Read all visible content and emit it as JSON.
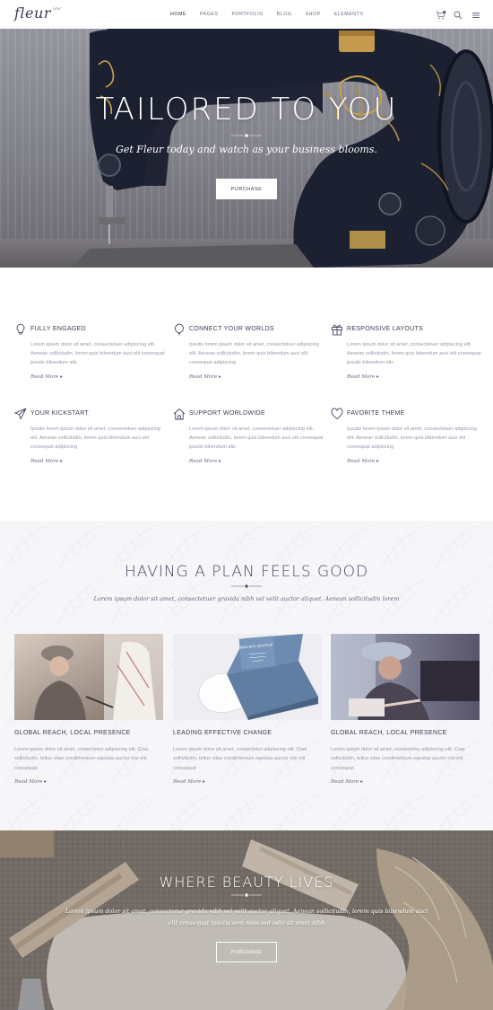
{
  "header": {
    "logo": "fleur",
    "nav": [
      "HOME",
      "PAGES",
      "PORTFOLIO",
      "BLOG",
      "SHOP",
      "ELEMENTS"
    ],
    "cart_count": "0"
  },
  "hero": {
    "title": "TAILORED TO YOU",
    "subtitle": "Get Fleur today and watch as your business blooms.",
    "button": "PURCHASE"
  },
  "features": [
    {
      "icon": "lightbulb-icon",
      "title": "FULLY ENGAGED",
      "text": "Lorem ipsum dolor sit amet, consectetuer adipiscing elit. Aenean sollicitudin, lorem quis bibendum auci elit consequat ipsutis bibendum alis",
      "more": "Read More ▸"
    },
    {
      "icon": "balloon-icon",
      "title": "CONNECT YOUR WORLDS",
      "text": "Ipsutis lorem ipsum dolor sit amet, consectetuer adipiscing elit. Aenean sollicitudin, lorem quis bibendum auci elit consequat adipiscing",
      "more": "Read More ▸"
    },
    {
      "icon": "gift-icon",
      "title": "RESPONSIVE LAYOUTS",
      "text": "Lorem ipsum dolor sit amet, consectetuer adipiscing elit. Aenean sollicitudin, lorem quis bibendum auci elit consequat ipsutis bibendum alis",
      "more": "Read More ▸"
    },
    {
      "icon": "paper-plane-icon",
      "title": "YOUR KICKSTART",
      "text": "Ipsutis lorem ipsum dolor sit amet, consectetuer adipiscing elit. Aenean sollicitudin, lorem quis bibendum auci elit consequat adipiscing",
      "more": "Read More ▸"
    },
    {
      "icon": "house-icon",
      "title": "SUPPORT WORLDWIDE",
      "text": "Lorem ipsum dolor sit amet, consectetuer adipiscing elit. Aenean sollicitudin, lorem quis bibendum auci elit consequat ipsutis bibendum alis",
      "more": "Read More ▸"
    },
    {
      "icon": "heart-icon",
      "title": "FAVORITE THEME",
      "text": "Ipsutis lorem ipsum dolor sit amet, consectetuer adipiscing elit. Aenean sollicitudin, lorem quis bibendum auci elit consequat adipiscing",
      "more": "Read More ▸"
    }
  ],
  "plan": {
    "title": "HAVING A PLAN FEELS GOOD",
    "subtitle": "Lorem ipsum dolor sit amet, consectetuer gravida nibh vel velit auctor aliquet. Aenean sollicitudin lorem",
    "cards": [
      {
        "title": "GLOBAL REACH, LOCAL PRESENCE",
        "text": "Lorem ipsum dolor sit amet, consectetur adipiscing elit. Cras sollicitudin, tellus vitae condimentum egestas auctor nisi elit consequat",
        "more": "Read More ▸"
      },
      {
        "title": "LEADING EFFECTIVE CHANGE",
        "text": "Lorem ipsum dolor sit amet, consectetur adipiscing elit. Cras sollicitudin, tellus vitae condimentum egestas auctor nisi elit consequat",
        "more": "Read More ▸",
        "box_text": "BAG BOX MOCKUP"
      },
      {
        "title": "GLOBAL REACH, LOCAL PRESENCE",
        "text": "Lorem ipsum dolor sit amet, consectetur adipiscing elit. Cras sollicitudin, tellus vitae condimentum egestas auctor nisi elit consequat",
        "more": "Read More ▸"
      }
    ]
  },
  "beauty": {
    "title": "WHERE BEAUTY LIVES",
    "subtitle": "Lorem ipsum dolor sit amet, consectetur gravida nibh vel velit auctor aliquet. Aenean sollicitudin, lorem quis bibendum auci elit consequat ipsutis sem nisis sed odio sit amet nibh",
    "button": "PURCHASE"
  },
  "colors": {
    "text_dark": "#3e3a55",
    "text_light": "#9a96aa",
    "accent": "#4a4666"
  }
}
